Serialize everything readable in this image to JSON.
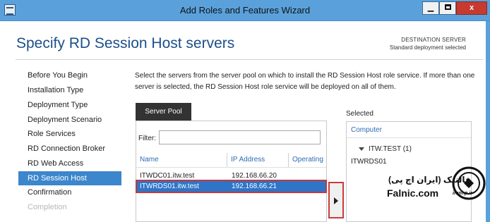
{
  "window": {
    "title": "Add Roles and Features Wizard",
    "close_label": "x"
  },
  "header": {
    "title": "Specify RD Session Host servers",
    "destination_label": "DESTINATION SERVER",
    "destination_value": "Standard deployment selected"
  },
  "nav": {
    "items": [
      {
        "label": "Before You Begin",
        "state": "normal"
      },
      {
        "label": "Installation Type",
        "state": "normal"
      },
      {
        "label": "Deployment Type",
        "state": "normal"
      },
      {
        "label": "Deployment Scenario",
        "state": "normal"
      },
      {
        "label": "Role Services",
        "state": "normal"
      },
      {
        "label": "RD Connection Broker",
        "state": "normal"
      },
      {
        "label": "RD Web Access",
        "state": "normal"
      },
      {
        "label": "RD Session Host",
        "state": "active"
      },
      {
        "label": "Confirmation",
        "state": "normal"
      },
      {
        "label": "Completion",
        "state": "disabled"
      }
    ]
  },
  "main": {
    "description": "Select the servers from the server pool on which to install the RD Session Host role service. If more than one server is selected, the RD Session Host role service will be deployed on all of them.",
    "pool": {
      "tab_label": "Server Pool",
      "filter_label": "Filter:",
      "filter_value": "",
      "columns": [
        "Name",
        "IP Address",
        "Operating"
      ],
      "rows": [
        {
          "name": "ITWDC01.itw.test",
          "ip": "192.168.66.20",
          "selected": false
        },
        {
          "name": "ITWRDS01.itw.test",
          "ip": "192.168.66.21",
          "selected": true
        }
      ]
    },
    "selected": {
      "label": "Selected",
      "column": "Computer",
      "group": "ITW.TEST (1)",
      "items": [
        "ITWRDS01"
      ]
    }
  },
  "watermark": {
    "persian": "فالنیک (ایران اچ پی)",
    "latin": "Falnic.com",
    "seal_text": "iranhp.ir"
  },
  "colors": {
    "titlebar": "#5aa1dc",
    "accent": "#3c86cc",
    "highlight_border": "#c6373a",
    "title_text": "#1b4f8a"
  }
}
